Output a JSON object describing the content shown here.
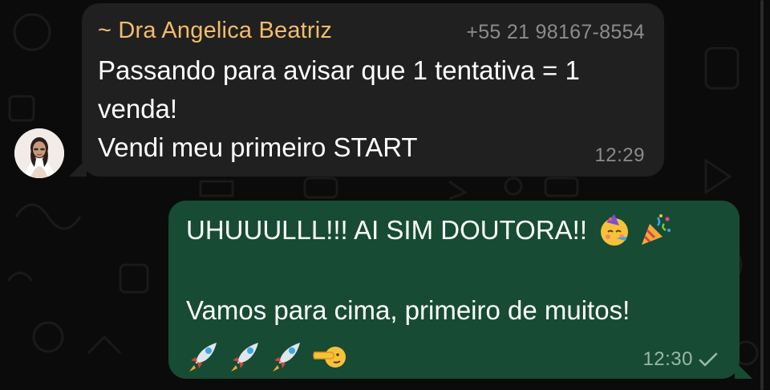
{
  "incoming_message": {
    "sender_name": "~ Dra Angelica Beatriz",
    "sender_phone": "+55 21 98167-8554",
    "lines": [
      "Passando para avisar que 1 tentativa = 1",
      "venda!",
      "Vendi meu primeiro START"
    ],
    "time": "12:29"
  },
  "outgoing_message": {
    "line1": "UHUUULLL!!! AI SIM DOUTORA!!",
    "line2": "Vamos para cima, primeiro de muitos!",
    "line1_emojis": [
      "partying-face-emoji",
      "party-popper-emoji"
    ],
    "line3_emojis": [
      "rocket-emoji",
      "rocket-emoji",
      "rocket-emoji",
      "pointing-left-emoji"
    ],
    "time": "12:30",
    "status": "sent-single-check"
  },
  "colors": {
    "background": "#0b0b0b",
    "incoming_bubble": "#202020",
    "outgoing_bubble": "#174b34",
    "sender_name": "#f3bd6b",
    "meta_text": "#8c8c8c"
  }
}
